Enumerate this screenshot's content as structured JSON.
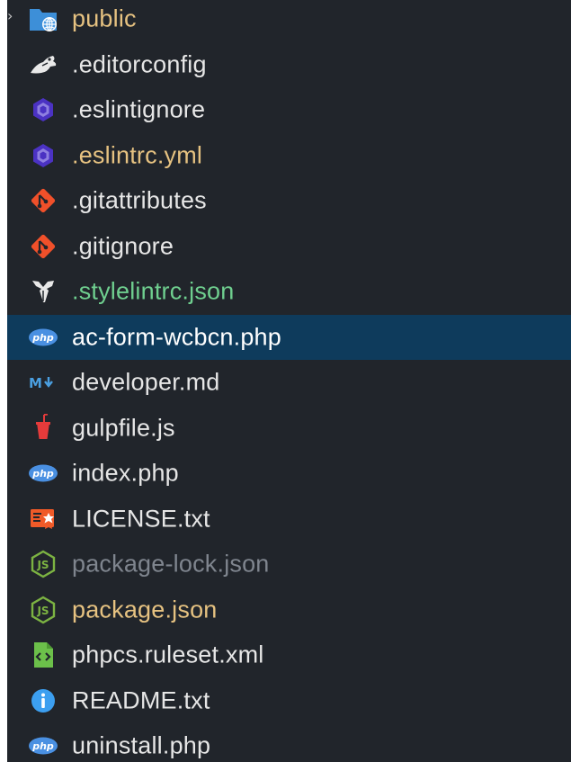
{
  "explorer": {
    "collapsed_indicator": "›",
    "items": [
      {
        "label": "public",
        "color": "#e6c281",
        "icon": "folder-globe-icon"
      },
      {
        "label": ".editorconfig",
        "color": "#e6e6e6",
        "icon": "editorconfig-icon"
      },
      {
        "label": ".eslintignore",
        "color": "#e6e6e6",
        "icon": "eslint-icon"
      },
      {
        "label": ".eslintrc.yml",
        "color": "#e6c281",
        "icon": "eslint-icon"
      },
      {
        "label": ".gitattributes",
        "color": "#e6e6e6",
        "icon": "git-icon"
      },
      {
        "label": ".gitignore",
        "color": "#e6e6e6",
        "icon": "git-icon"
      },
      {
        "label": ".stylelintrc.json",
        "color": "#6fcf8f",
        "icon": "stylelint-icon"
      },
      {
        "label": "ac-form-wcbcn.php",
        "color": "#ffffff",
        "icon": "php-icon",
        "selected": true
      },
      {
        "label": "developer.md",
        "color": "#e6e6e6",
        "icon": "markdown-icon"
      },
      {
        "label": "gulpfile.js",
        "color": "#e6e6e6",
        "icon": "gulp-icon"
      },
      {
        "label": "index.php",
        "color": "#e6e6e6",
        "icon": "php-icon"
      },
      {
        "label": "LICENSE.txt",
        "color": "#e6e6e6",
        "icon": "license-icon"
      },
      {
        "label": "package-lock.json",
        "color": "#7f858e",
        "icon": "nodejs-icon"
      },
      {
        "label": "package.json",
        "color": "#e6c281",
        "icon": "nodejs-icon"
      },
      {
        "label": "phpcs.ruleset.xml",
        "color": "#e6e6e6",
        "icon": "xml-file-icon"
      },
      {
        "label": "README.txt",
        "color": "#e6e6e6",
        "icon": "info-icon"
      },
      {
        "label": "uninstall.php",
        "color": "#e6e6e6",
        "icon": "php-icon"
      }
    ]
  },
  "colors": {
    "background": "#21252b",
    "selection": "#0e3b5c"
  }
}
